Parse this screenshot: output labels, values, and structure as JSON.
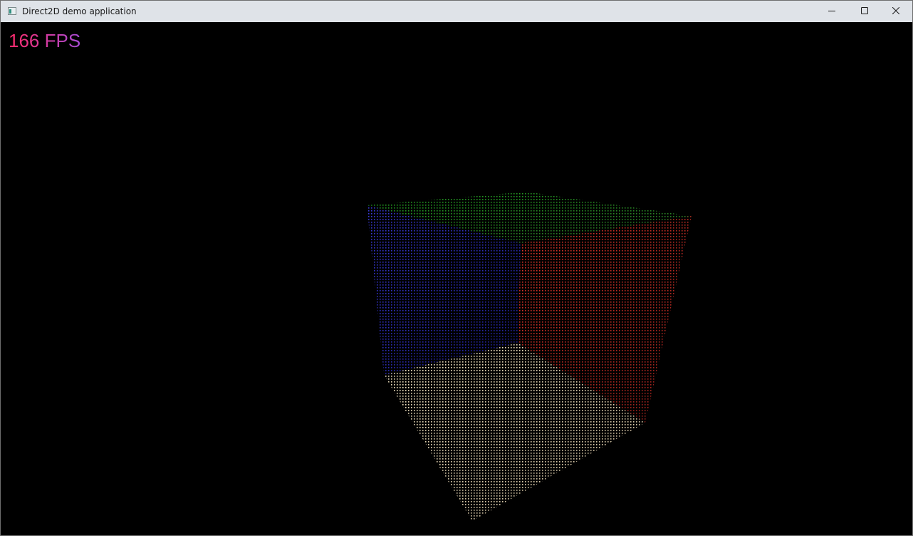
{
  "window": {
    "title": "Direct2D demo application",
    "app_icon": "window-app-icon",
    "controls": {
      "minimize_icon": "minimize-icon",
      "maximize_icon": "maximize-icon",
      "close_icon": "close-icon"
    }
  },
  "overlay": {
    "fps_label": "166 FPS"
  },
  "scene": {
    "description_type": "point-cloud cube",
    "faces": [
      {
        "name": "top",
        "colors": [
          "#1fa31f",
          "#2f6f28"
        ]
      },
      {
        "name": "left",
        "colors": [
          "#3a3ad6",
          "#1f1f8f"
        ]
      },
      {
        "name": "right",
        "colors": [
          "#e0362a",
          "#8f1f1a"
        ]
      },
      {
        "name": "bottom",
        "colors": [
          "#f3e6c4",
          "#c9b89a"
        ]
      }
    ]
  }
}
